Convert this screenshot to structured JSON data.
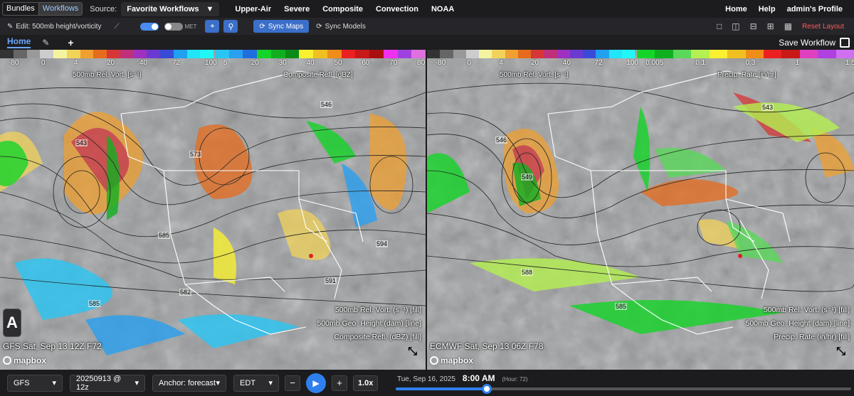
{
  "topbar": {
    "bundles": "Bundles",
    "workflows": "Workflows",
    "source_label": "Source:",
    "source_value": "Favorite Workflows",
    "nav": [
      "Upper-Air",
      "Severe",
      "Composite",
      "Convection",
      "NOAA"
    ],
    "right": [
      "Home",
      "Help",
      "admin's Profile"
    ]
  },
  "toolbar": {
    "edit_label": "Edit: 500mb height/vorticity",
    "met_label": "MET",
    "sync_maps": "Sync Maps",
    "sync_models": "Sync Models",
    "reset_layout": "Reset Layout"
  },
  "tabs": {
    "home": "Home",
    "add": "+",
    "save_workflow": "Save Workflow"
  },
  "panels": [
    {
      "colorbar_left": {
        "ticks": [
          "-80",
          "0",
          "4",
          "20",
          "40",
          "72",
          "100"
        ],
        "title": "500mb Rel. Vort. [s⁻¹]",
        "colors": [
          "#333333",
          "#666666",
          "#999999",
          "#cccccc",
          "#f4f4a0",
          "#f2d35a",
          "#f0a030",
          "#e66b1c",
          "#d63636",
          "#c0307a",
          "#a030c0",
          "#6a3ad0",
          "#3a4ad8",
          "#20a0f0",
          "#20e6f8",
          "#20f8f8"
        ]
      },
      "colorbar_right": {
        "ticks": [
          "5",
          "20",
          "30",
          "40",
          "50",
          "60",
          "70",
          "80"
        ],
        "title": "Composite Refl. [dBZ]",
        "colors": [
          "#29c6f4",
          "#2aa0f0",
          "#1f6ee0",
          "#14d428",
          "#0fb020",
          "#0a8c18",
          "#f8f030",
          "#f0c020",
          "#f08c18",
          "#ec2020",
          "#c81818",
          "#a81010",
          "#f030f0",
          "#a040e0",
          "#e070e0"
        ]
      },
      "legend": [
        "500mb Rel. Vort. (s⁻¹) [fill]",
        "500mb Geo. Height (dam) [line]",
        "Composite Refl. (dBZ) [fill]"
      ],
      "stamp": "GFS Sat, Sep 13 12Z F72",
      "heights": [
        "543",
        "573",
        "546",
        "585",
        "582",
        "585",
        "594",
        "591"
      ]
    },
    {
      "colorbar_left": {
        "ticks": [
          "-80",
          "0",
          "4",
          "20",
          "40",
          "72",
          "100"
        ],
        "title": "500mb Rel. Vort. [s⁻¹]",
        "colors": [
          "#333333",
          "#666666",
          "#999999",
          "#cccccc",
          "#f4f4a0",
          "#f2d35a",
          "#f0a030",
          "#e66b1c",
          "#d63636",
          "#c0307a",
          "#a030c0",
          "#6a3ad0",
          "#3a4ad8",
          "#20a0f0",
          "#20e6f8",
          "#20f8f8"
        ]
      },
      "colorbar_right": {
        "ticks": [
          "0.005",
          "0.1",
          "0.3",
          "1",
          "1.5"
        ],
        "title": "Precip. Rate [in/hr]",
        "colors": [
          "#14d428",
          "#0fb020",
          "#5ad85a",
          "#b4f050",
          "#f8f030",
          "#f0c020",
          "#f08c18",
          "#ec2020",
          "#c81818",
          "#e040c0",
          "#b040e0",
          "#d070f0"
        ]
      },
      "legend": [
        "500mb Rel. Vort. (s⁻¹) [fill]",
        "500mb Geo. Height (dam) [line]",
        "Precip. Rate (in/hr) [fill]"
      ],
      "stamp": "ECMWF Sat, Sep 13 06Z F78",
      "heights": [
        "546",
        "543",
        "549",
        "588",
        "585"
      ]
    }
  ],
  "panel_label": "A",
  "mapbox": "mapbox",
  "bottom": {
    "model": "GFS",
    "run": "20250913 @ 12z",
    "anchor": "Anchor: forecast",
    "tz": "EDT",
    "minus": "−",
    "plus": "+",
    "speed": "1.0x",
    "date": "Tue, Sep 16, 2025",
    "time": "8:00 AM",
    "hour": "(Hour: 72)",
    "progress": 0.2
  },
  "colors": {
    "accent": "#2f80ed",
    "reset": "#ff5a5a"
  }
}
